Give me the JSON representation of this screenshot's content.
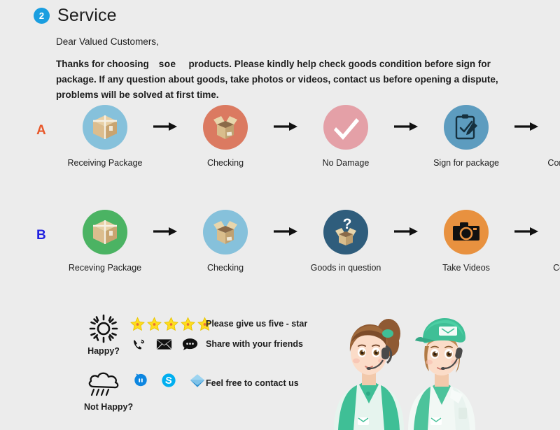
{
  "header": {
    "badge_number": "2",
    "title": "Service",
    "badge_color": "#1a9ee0"
  },
  "intro": {
    "greeting": "Dear Valued Customers,",
    "line_before_brand": "Thanks for choosing",
    "brand": "soe",
    "line_after_brand": "products. Please kindly help check goods condition before sign for package. If any question about goods, take photos or videos, contact us before opening a dispute, problems will be solved at first time."
  },
  "flows": [
    {
      "letter": "A",
      "letter_color": "#e8582a",
      "steps": [
        {
          "label": "Receiving Package",
          "icon": "closed-box-icon",
          "circle_color": "#86c1db"
        },
        {
          "label": "Checking",
          "icon": "open-box-icon",
          "circle_color": "#db7a61"
        },
        {
          "label": "No Damage",
          "icon": "checkmark-icon",
          "circle_color": "#e4a0a7"
        },
        {
          "label": "Sign for package",
          "icon": "clipboard-pencil-icon",
          "circle_color": "#5d9cbf"
        },
        {
          "label": "Confirm the delivery",
          "icon": "handshake-icon",
          "circle_color": "#f3c79d"
        }
      ]
    },
    {
      "letter": "B",
      "letter_color": "#2020e0",
      "steps": [
        {
          "label": "Receving Package",
          "icon": "closed-box-icon",
          "circle_color": "#4bb363"
        },
        {
          "label": "Checking",
          "icon": "open-box-icon",
          "circle_color": "#86c1db"
        },
        {
          "label": "Goods in question",
          "icon": "question-box-icon",
          "circle_color": "#2f5d7c"
        },
        {
          "label": "Take Videos",
          "icon": "camera-icon",
          "circle_color": "#e8913f"
        },
        {
          "label": "Confirm problem,\nrefund money",
          "icon": "support-agent-icon",
          "circle_color": "#8c5cb8"
        }
      ]
    }
  ],
  "arrow": {
    "name": "right-arrow-icon",
    "color": "#111111"
  },
  "bottom": {
    "happy": {
      "icon": "sun-icon",
      "label": "Happy?",
      "star_count": 5,
      "star_color": "#ffdd1f",
      "contact_icons": [
        "phone-ring-icon",
        "envelope-icon",
        "chat-bubble-icon"
      ],
      "text_primary": "Please give us five - star",
      "text_secondary": "Share with your friends"
    },
    "not_happy": {
      "icon": "rain-cloud-icon",
      "label": "Not Happy?",
      "contact_icons": [
        "aliwangwang-icon",
        "skype-icon",
        "mail-message-icon"
      ],
      "text_primary": "Feel free to contact us"
    },
    "agents": {
      "name": "customer-service-agents-illustration",
      "agent_left": "female-agent-with-headset",
      "agent_right": "agent-with-green-cap"
    }
  }
}
